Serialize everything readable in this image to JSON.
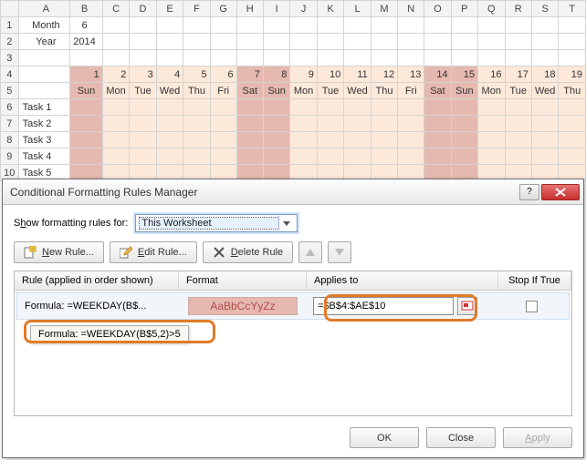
{
  "columns": [
    "",
    "A",
    "B",
    "C",
    "D",
    "E",
    "F",
    "G",
    "H",
    "I",
    "J",
    "K",
    "L",
    "M",
    "N",
    "O",
    "P",
    "Q",
    "R",
    "S",
    "T"
  ],
  "cells": {
    "A1": "Month",
    "B1": "6",
    "A2": "Year",
    "B2": "2014"
  },
  "row4": [
    "1",
    "2",
    "3",
    "4",
    "5",
    "6",
    "7",
    "8",
    "9",
    "10",
    "11",
    "12",
    "13",
    "14",
    "15",
    "16",
    "17",
    "18",
    "19"
  ],
  "row5": [
    "Sun",
    "Mon",
    "Tue",
    "Wed",
    "Thu",
    "Fri",
    "Sat",
    "Sun",
    "Mon",
    "Tue",
    "Wed",
    "Thu",
    "Fri",
    "Sat",
    "Sun",
    "Mon",
    "Tue",
    "Wed",
    "Thu"
  ],
  "tasks": [
    "Task 1",
    "Task 2",
    "Task 3",
    "Task 4",
    "Task 5"
  ],
  "weekend_cols": [
    0,
    6,
    7,
    13,
    14
  ],
  "dialog": {
    "title": "Conditional Formatting Rules Manager",
    "show_label_pre": "S",
    "show_label_u": "h",
    "show_label_post": "ow formatting rules for:",
    "select_value": "This Worksheet",
    "new_rule_u": "N",
    "new_rule": "ew Rule...",
    "edit_rule_u": "E",
    "edit_rule": "dit Rule...",
    "delete_rule_u": "D",
    "delete_rule": "elete Rule",
    "col_rule": "Rule (applied in order shown)",
    "col_format": "Format",
    "col_applies": "Applies to",
    "col_stop": "Stop If True",
    "rule_text": "Formula: =WEEKDAY(B$...",
    "sample_text": "AaBbCcYyZz",
    "applies_value": "=$B$4:$AE$10",
    "tooltip": "Formula: =WEEKDAY(B$5,2)>5",
    "ok": "OK",
    "close": "Close",
    "apply_u": "A",
    "apply": "pply"
  }
}
